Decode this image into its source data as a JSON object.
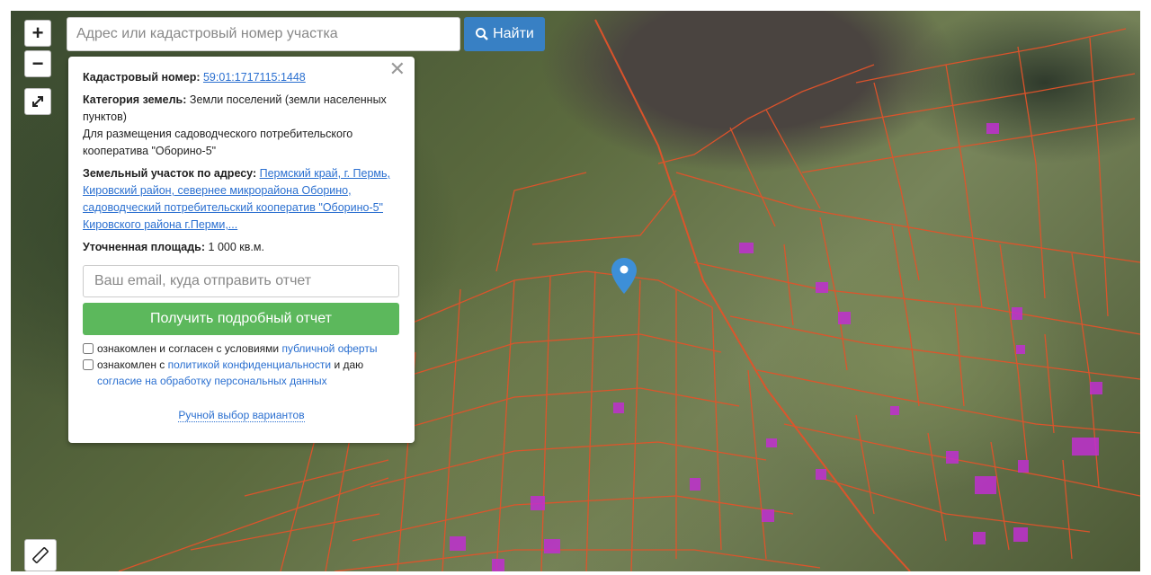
{
  "controls": {
    "zoom_in": "+",
    "zoom_out": "−",
    "fullscreen_icon": "expand-icon",
    "ruler_icon": "ruler-icon"
  },
  "search": {
    "placeholder": "Адрес или кадастровый номер участка",
    "button_label": "Найти",
    "button_icon": "search-icon",
    "button_color": "#3880c4"
  },
  "popup": {
    "cadastral_label": "Кадастровый номер:",
    "cadastral_number": "59:01:1717115:1448",
    "category_label": "Категория земель:",
    "category_value": "Земли поселений (земли населенных пунктов)",
    "purpose": "Для размещения садоводческого потребительского кооператива \"Оборино-5\"",
    "address_label": "Земельный участок по адресу:",
    "address_value": "Пермский край, г. Пермь, Кировский район, севернее микрорайона Оборино, садоводческий потребительский кооператив \"Оборино-5\" Кировского района г.Перми,...",
    "area_label": "Уточненная площадь:",
    "area_value": "1 000 кв.м.",
    "email_placeholder": "Ваш email, куда отправить отчет",
    "report_button": "Получить подробный отчет",
    "report_button_color": "#5cb85c",
    "consent1_text": "ознакомлен и согласен с условиями",
    "consent1_link": "публичной оферты",
    "consent2_text": "ознакомлен с",
    "consent2_link": "политикой конфиденциальности",
    "consent2_middle": "и даю",
    "consent2_link2": "согласие на обработку персональных данных",
    "manual_link": "Ручной выбор вариантов",
    "close_icon": "close-icon"
  },
  "map": {
    "parcel_color": "#e2532a",
    "marker_color": "#3d8fd8"
  }
}
